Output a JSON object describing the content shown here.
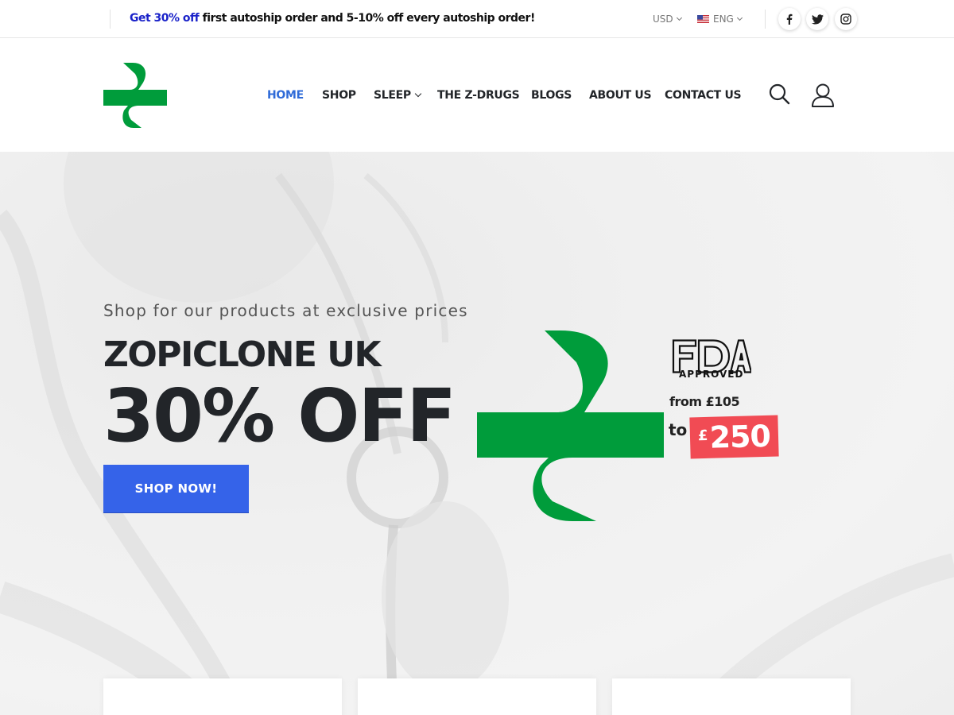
{
  "topbar": {
    "promo_highlight": "Get 30% off",
    "promo_rest": " first autoship order and 5-10% off every autoship order!",
    "currency": "USD",
    "language": "ENG",
    "social": [
      "facebook-icon",
      "twitter-icon",
      "instagram-icon"
    ]
  },
  "nav": {
    "items": [
      {
        "label": "HOME",
        "active": true
      },
      {
        "label": "SHOP"
      },
      {
        "label": "SLEEP",
        "has_dropdown": true
      },
      {
        "label": "THE Z-DRUGS"
      },
      {
        "label": "BLOGS"
      },
      {
        "label": "ABOUT US"
      },
      {
        "label": "CONTACT US"
      }
    ],
    "icons": [
      "search-icon",
      "user-icon"
    ]
  },
  "hero": {
    "subtitle": "Shop for our products at exclusive prices",
    "headline": "ZOPICLONE UK",
    "offer": "30% OFF",
    "button_label": "SHOP NOW!",
    "fda_text": "FDA",
    "fda_approved": "APPROVED",
    "price_from": "from £105",
    "price_to_label": "to",
    "price_currency": "£",
    "price_value": "250"
  },
  "colors": {
    "brand_green": "#009c3b",
    "accent_blue": "#3563e9",
    "active_nav": "#2f6bd8",
    "price_red": "#f14b54",
    "promo_blue": "#1a22c9"
  }
}
